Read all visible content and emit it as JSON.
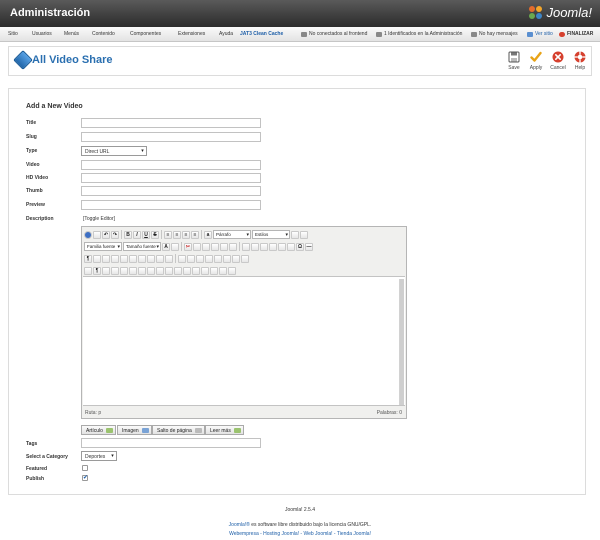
{
  "app": {
    "title": "Administración",
    "logo_text": "Joomla!"
  },
  "menu": {
    "items": [
      "Sitio",
      "Usuarios",
      "Menús",
      "Contenido",
      "Componentes",
      "Extensiones",
      "Ayuda"
    ],
    "cache_link": "JAT3 Clean Cache",
    "frontend_status": "No conectados al frontend",
    "admin_status": "1 Identificados en la Administración",
    "messages": "No hay mensajes",
    "view_site": "Ver sitio",
    "logout": "FINALIZAR"
  },
  "header": {
    "title": "All Video Share",
    "buttons": {
      "save": "Save",
      "apply": "Apply",
      "cancel": "Cancel",
      "help": "Help"
    }
  },
  "form": {
    "heading": "Add a New Video",
    "labels": {
      "title": "Title",
      "slug": "Slug",
      "type": "Type",
      "video": "Video",
      "hd_video": "HD Video",
      "thumb": "Thumb",
      "preview": "Preview",
      "description": "Description",
      "tags": "Tags",
      "category": "Select a Category",
      "featured": "Featured",
      "publish": "Publish"
    },
    "type_value": "Direct URL",
    "category_value": "Deportes",
    "toggle_editor": "[Toggle Editor]",
    "featured_checked": false,
    "publish_checked": true
  },
  "editor": {
    "paragraph_select": "Párrafo",
    "styles_select": "Estilos",
    "font_family_select": "Familia fuente",
    "font_size_select": "Tamaño fuente",
    "path_label": "Ruta:",
    "path_value": "p",
    "word_count": "Palabras: 0",
    "extra_buttons": {
      "article": "Artículo",
      "image": "Imagen",
      "page_break": "Salto de página",
      "read_more": "Leer más"
    }
  },
  "footer": {
    "version": "Joomla! 2.5.4",
    "license_link": "Joomla!®",
    "license_text": "es software libre distribuido bajo la licencia GNU/GPL.",
    "links": "Webempresa - Hosting Joomla! - Web Joomla! - Tienda Joomla!"
  },
  "colors": {
    "topbar": "#3a3a3a",
    "link": "#1d5ea7",
    "save_icon": "#555555",
    "apply_icon": "#e8a317",
    "cancel_icon": "#d6402e",
    "help_icon": "#d6402e"
  }
}
